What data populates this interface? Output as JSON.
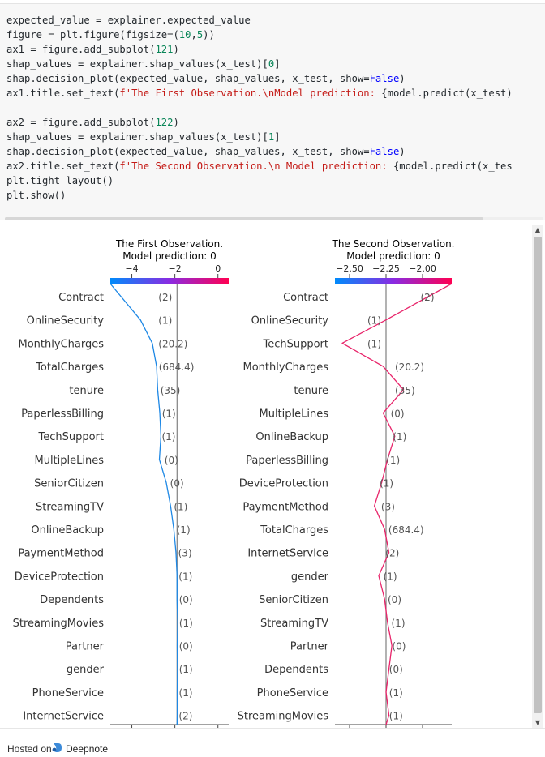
{
  "code": {
    "lines": [
      [
        {
          "t": "expected_value = explainer.expected_value",
          "c": ""
        }
      ],
      [
        {
          "t": "figure = plt.figure(figsize=(",
          "c": ""
        },
        {
          "t": "10",
          "c": "kw-num"
        },
        {
          "t": ",",
          "c": ""
        },
        {
          "t": "5",
          "c": "kw-num"
        },
        {
          "t": "))",
          "c": ""
        }
      ],
      [
        {
          "t": "ax1 = figure.add_subplot(",
          "c": ""
        },
        {
          "t": "121",
          "c": "kw-num"
        },
        {
          "t": ")",
          "c": ""
        }
      ],
      [
        {
          "t": "shap_values = explainer.shap_values(x_test)[",
          "c": ""
        },
        {
          "t": "0",
          "c": "kw-num"
        },
        {
          "t": "]",
          "c": ""
        }
      ],
      [
        {
          "t": "shap.decision_plot(expected_value, shap_values, x_test, show=",
          "c": ""
        },
        {
          "t": "False",
          "c": "kw-const"
        },
        {
          "t": ")",
          "c": ""
        }
      ],
      [
        {
          "t": "ax1.title.set_text(",
          "c": ""
        },
        {
          "t": "f'The First Observation.\\nModel prediction: ",
          "c": "kw-str"
        },
        {
          "t": "{model.predict(x_test)",
          "c": ""
        }
      ],
      [
        {
          "t": "",
          "c": ""
        }
      ],
      [
        {
          "t": "ax2 = figure.add_subplot(",
          "c": ""
        },
        {
          "t": "122",
          "c": "kw-num"
        },
        {
          "t": ")",
          "c": ""
        }
      ],
      [
        {
          "t": "shap_values = explainer.shap_values(x_test)[",
          "c": ""
        },
        {
          "t": "1",
          "c": "kw-num"
        },
        {
          "t": "]",
          "c": ""
        }
      ],
      [
        {
          "t": "shap.decision_plot(expected_value, shap_values, x_test, show=",
          "c": ""
        },
        {
          "t": "False",
          "c": "kw-const"
        },
        {
          "t": ")",
          "c": ""
        }
      ],
      [
        {
          "t": "ax2.title.set_text(",
          "c": ""
        },
        {
          "t": "f'The Second Observation.\\n Model prediction: ",
          "c": "kw-str"
        },
        {
          "t": "{model.predict(x_tes",
          "c": ""
        }
      ],
      [
        {
          "t": "plt.tight_layout()",
          "c": ""
        }
      ],
      [
        {
          "t": "plt.show()",
          "c": ""
        }
      ]
    ]
  },
  "chart_data": [
    {
      "type": "line",
      "title": "The First Observation.\nModel prediction: 0",
      "xlim": [
        -5.0,
        0.5
      ],
      "xticks": [
        -4,
        -2,
        0
      ],
      "xtick_labels": [
        "−4",
        "−2",
        "0"
      ],
      "base_value": -1.9,
      "line_color": "#1e88e5",
      "features": [
        "Contract",
        "OnlineSecurity",
        "MonthlyCharges",
        "TotalCharges",
        "tenure",
        "PaperlessBilling",
        "TechSupport",
        "MultipleLines",
        "SeniorCitizen",
        "StreamingTV",
        "OnlineBackup",
        "PaymentMethod",
        "DeviceProtection",
        "Dependents",
        "StreamingMovies",
        "Partner",
        "gender",
        "PhoneService",
        "InternetService"
      ],
      "feature_values": [
        "(2)",
        "(1)",
        "(20.2)",
        "(684.4)",
        "(35)",
        "(1)",
        "(1)",
        "(0)",
        "(0)",
        "(1)",
        "(1)",
        "(3)",
        "(1)",
        "(0)",
        "(1)",
        "(0)",
        "(1)",
        "(1)",
        "(2)"
      ],
      "path": [
        -5.0,
        -3.6,
        -3.05,
        -2.85,
        -2.8,
        -2.7,
        -2.65,
        -2.72,
        -2.4,
        -2.2,
        -2.05,
        -1.95,
        -1.9,
        -1.9,
        -1.87,
        -1.89,
        -1.88,
        -1.89,
        -1.89,
        -1.9
      ]
    },
    {
      "type": "line",
      "title": "The Second Observation.\n Model prediction: 0",
      "xlim": [
        -2.6,
        -1.8
      ],
      "xticks": [
        -2.5,
        -2.25,
        -2.0
      ],
      "xtick_labels": [
        "−2.50",
        "−2.25",
        "−2.00"
      ],
      "base_value": -2.25,
      "line_color": "#e8246a",
      "features": [
        "Contract",
        "OnlineSecurity",
        "TechSupport",
        "MonthlyCharges",
        "tenure",
        "MultipleLines",
        "OnlineBackup",
        "PaperlessBilling",
        "DeviceProtection",
        "PaymentMethod",
        "TotalCharges",
        "InternetService",
        "gender",
        "SeniorCitizen",
        "StreamingTV",
        "Partner",
        "Dependents",
        "PhoneService",
        "StreamingMovies"
      ],
      "feature_values": [
        "(2)",
        "(1)",
        "(1)",
        "(20.2)",
        "(35)",
        "(0)",
        "(1)",
        "(1)",
        "(1)",
        "(3)",
        "(684.4)",
        "(2)",
        "(1)",
        "(0)",
        "(1)",
        "(0)",
        "(0)",
        "(1)",
        "(1)"
      ],
      "path": [
        -1.8,
        -2.25,
        -2.55,
        -2.27,
        -2.13,
        -2.27,
        -2.19,
        -2.24,
        -2.28,
        -2.33,
        -2.26,
        -2.23,
        -2.3,
        -2.26,
        -2.24,
        -2.21,
        -2.23,
        -2.25,
        -2.23,
        -2.25
      ]
    }
  ],
  "colorbar": {
    "from": "#008bfb",
    "mid": "#8a2be2",
    "to": "#ff0052"
  },
  "footer": {
    "hosted_on": "Hosted on",
    "brand": "Deepnote"
  }
}
